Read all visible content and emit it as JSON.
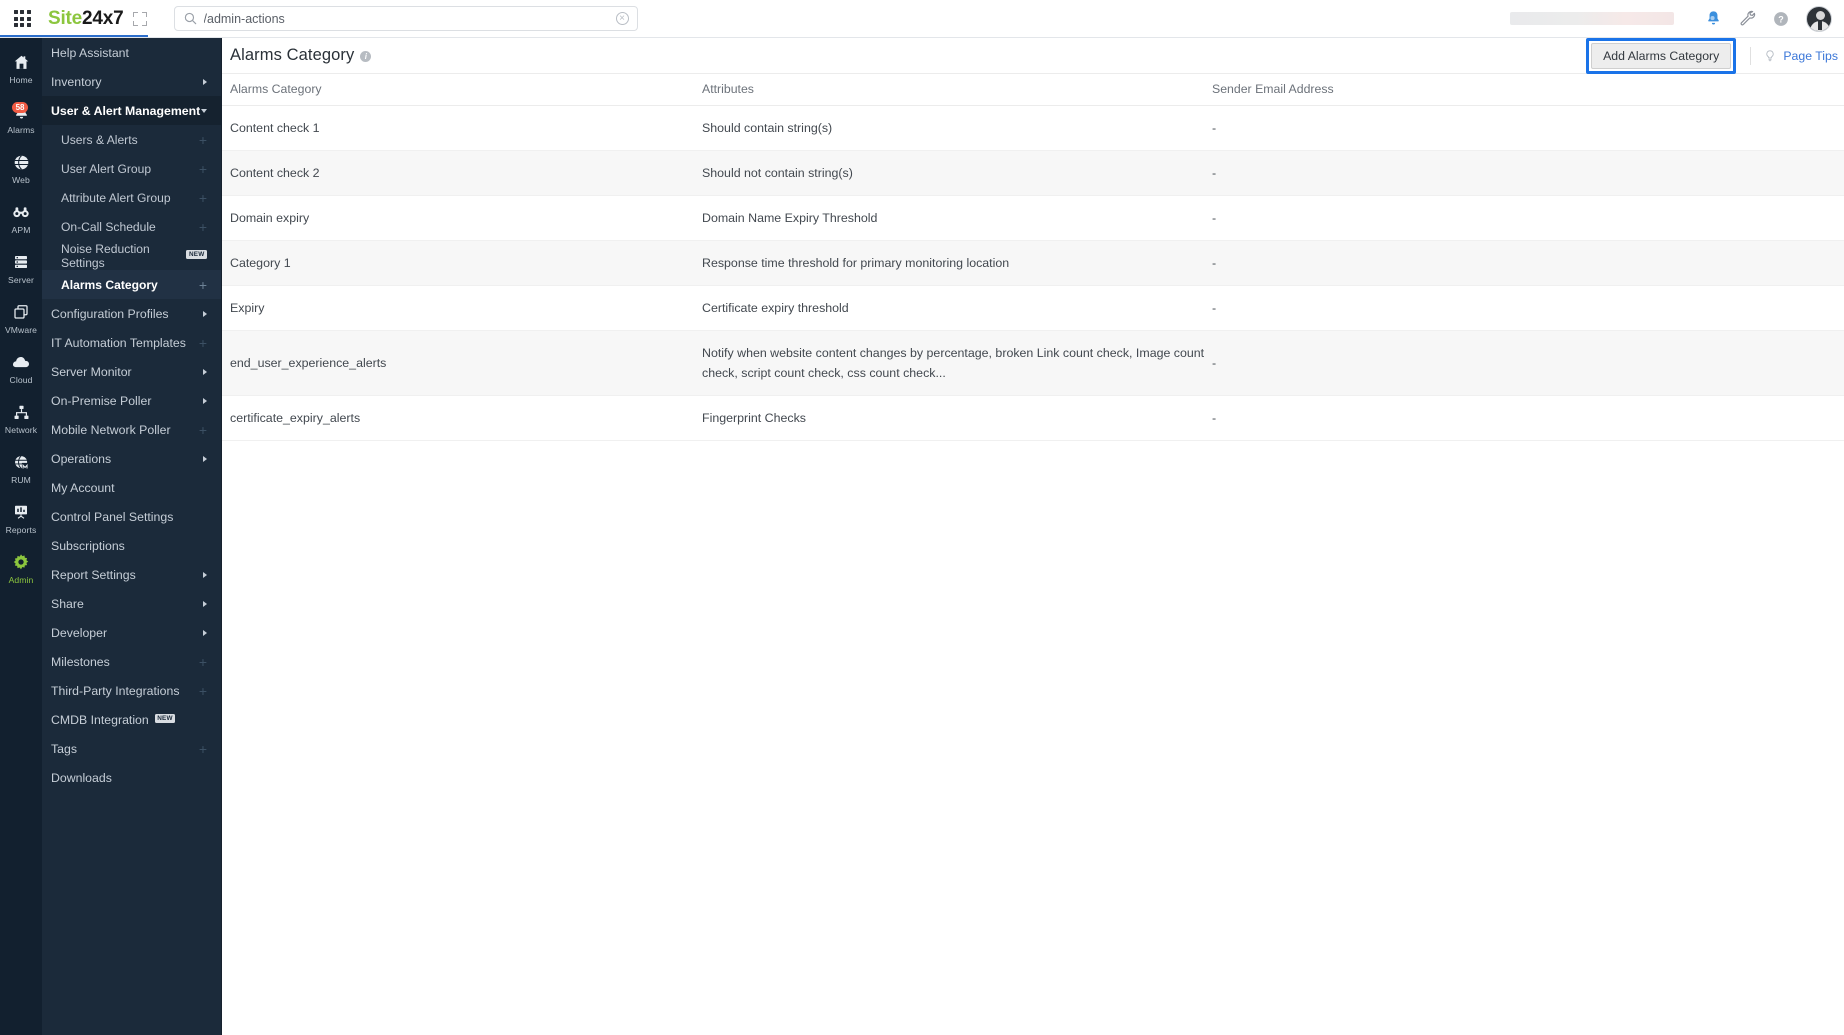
{
  "topbar": {
    "brand_prefix": "Site",
    "brand_suffix": "24x7",
    "search_value": "/admin-actions",
    "search_placeholder": "Search",
    "apps_icon": "apps-grid-icon",
    "expand_icon": "expand-fullscreen-icon",
    "clear_icon": "clear-search-icon",
    "bell_icon": "notifications-bell-icon",
    "wrench_icon": "tools-wrench-icon",
    "help_icon": "help-question-icon",
    "avatar_icon": "user-avatar"
  },
  "rail": {
    "items": [
      {
        "label": "Home",
        "icon": "home-icon",
        "active": false,
        "badge": ""
      },
      {
        "label": "Alarms",
        "icon": "alarms-bell-icon",
        "active": false,
        "badge": "58"
      },
      {
        "label": "Web",
        "icon": "web-globe-icon",
        "active": false,
        "badge": ""
      },
      {
        "label": "APM",
        "icon": "apm-binoculars-icon",
        "active": false,
        "badge": ""
      },
      {
        "label": "Server",
        "icon": "server-stack-icon",
        "active": false,
        "badge": ""
      },
      {
        "label": "VMware",
        "icon": "vmware-layers-icon",
        "active": false,
        "badge": ""
      },
      {
        "label": "Cloud",
        "icon": "cloud-icon",
        "active": false,
        "badge": ""
      },
      {
        "label": "Network",
        "icon": "network-topology-icon",
        "active": false,
        "badge": ""
      },
      {
        "label": "RUM",
        "icon": "rum-globe-icon",
        "active": false,
        "badge": ""
      },
      {
        "label": "Reports",
        "icon": "reports-chart-icon",
        "active": false,
        "badge": ""
      },
      {
        "label": "Admin",
        "icon": "admin-gear-icon",
        "active": true,
        "badge": ""
      }
    ]
  },
  "subnav": {
    "items": [
      {
        "label": "Help Assistant",
        "indent": "group",
        "state": "",
        "affordance": "none"
      },
      {
        "label": "Inventory",
        "indent": "group",
        "state": "",
        "affordance": "caret-right"
      },
      {
        "label": "User & Alert Management",
        "indent": "group",
        "state": "expanded",
        "affordance": "caret-down"
      },
      {
        "label": "Users & Alerts",
        "indent": "sub",
        "state": "",
        "affordance": "plus"
      },
      {
        "label": "User Alert Group",
        "indent": "sub",
        "state": "",
        "affordance": "plus"
      },
      {
        "label": "Attribute Alert Group",
        "indent": "sub",
        "state": "",
        "affordance": "plus"
      },
      {
        "label": "On-Call Schedule",
        "indent": "sub",
        "state": "",
        "affordance": "plus"
      },
      {
        "label": "Noise Reduction Settings",
        "indent": "sub",
        "state": "",
        "affordance": "none",
        "tag": "NEW"
      },
      {
        "label": "Alarms Category",
        "indent": "sub",
        "state": "selected",
        "affordance": "plus"
      },
      {
        "label": "Configuration Profiles",
        "indent": "group",
        "state": "",
        "affordance": "caret-right"
      },
      {
        "label": "IT Automation Templates",
        "indent": "group",
        "state": "",
        "affordance": "plus"
      },
      {
        "label": "Server Monitor",
        "indent": "group",
        "state": "",
        "affordance": "caret-right"
      },
      {
        "label": "On-Premise Poller",
        "indent": "group",
        "state": "",
        "affordance": "caret-right"
      },
      {
        "label": "Mobile Network Poller",
        "indent": "group",
        "state": "",
        "affordance": "plus"
      },
      {
        "label": "Operations",
        "indent": "group",
        "state": "",
        "affordance": "caret-right"
      },
      {
        "label": "My Account",
        "indent": "group",
        "state": "",
        "affordance": "none"
      },
      {
        "label": "Control Panel Settings",
        "indent": "group",
        "state": "",
        "affordance": "none"
      },
      {
        "label": "Subscriptions",
        "indent": "group",
        "state": "",
        "affordance": "none"
      },
      {
        "label": "Report Settings",
        "indent": "group",
        "state": "",
        "affordance": "caret-right"
      },
      {
        "label": "Share",
        "indent": "group",
        "state": "",
        "affordance": "caret-right"
      },
      {
        "label": "Developer",
        "indent": "group",
        "state": "",
        "affordance": "caret-right"
      },
      {
        "label": "Milestones",
        "indent": "group",
        "state": "",
        "affordance": "plus"
      },
      {
        "label": "Third-Party Integrations",
        "indent": "group",
        "state": "",
        "affordance": "plus"
      },
      {
        "label": "CMDB Integration",
        "indent": "group",
        "state": "",
        "affordance": "none",
        "tag": "NEW"
      },
      {
        "label": "Tags",
        "indent": "group",
        "state": "",
        "affordance": "plus"
      },
      {
        "label": "Downloads",
        "indent": "group",
        "state": "",
        "affordance": "none"
      }
    ]
  },
  "page": {
    "title": "Alarms Category",
    "info_icon": "info-icon",
    "add_button_label": "Add Alarms Category",
    "add_button_focused": true,
    "page_tips_label": "Page Tips",
    "page_tips_icon": "lightbulb-icon",
    "focus_ring_color": "#1a73e8"
  },
  "table": {
    "columns": [
      "Alarms Category",
      "Attributes",
      "Sender Email Address"
    ],
    "rows": [
      {
        "category": "Content check 1",
        "attributes": "Should contain string(s)",
        "sender_email": "-"
      },
      {
        "category": "Content check 2",
        "attributes": "Should not contain string(s)",
        "sender_email": "-"
      },
      {
        "category": "Domain expiry",
        "attributes": "Domain Name Expiry Threshold",
        "sender_email": "-"
      },
      {
        "category": "Category 1",
        "attributes": "Response time threshold for primary monitoring location",
        "sender_email": "-"
      },
      {
        "category": "Expiry",
        "attributes": "Certificate expiry threshold",
        "sender_email": "-"
      },
      {
        "category": "end_user_experience_alerts",
        "attributes": "Notify when website content changes by percentage, broken Link count check, Image count check, script count check, css count check...",
        "sender_email": "-"
      },
      {
        "category": "certificate_expiry_alerts",
        "attributes": "Fingerprint Checks",
        "sender_email": "-"
      }
    ]
  }
}
